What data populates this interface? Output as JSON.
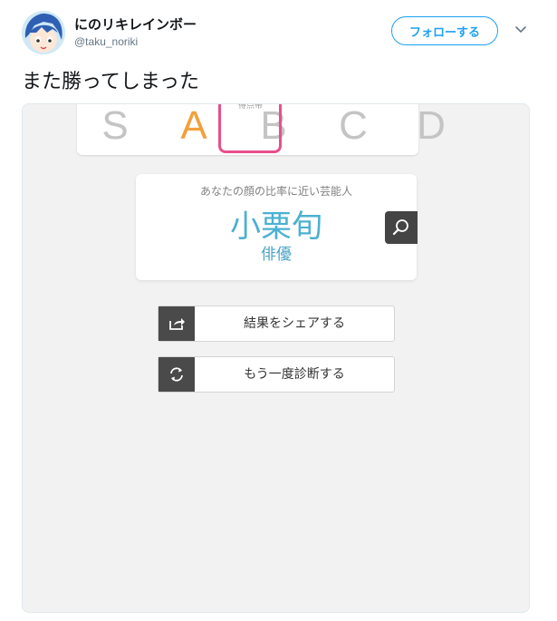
{
  "user": {
    "display_name": "にのリキレインボー",
    "handle": "@taku_noriki"
  },
  "follow_label": "フォローする",
  "tweet_text": "また勝ってしまった",
  "screenshot": {
    "grade_caption": "得点帯",
    "grades": [
      "S",
      "A",
      "B",
      "C",
      "D"
    ],
    "selected_grade": "A",
    "result_heading": "あなたの顔の比率に近い芸能人",
    "result_name": "小栗旬",
    "result_role": "俳優",
    "share_label": "結果をシェアする",
    "retry_label": "もう一度診断する"
  },
  "colors": {
    "accent_blue": "#1da1f2",
    "grade_highlight": "#e84f8d",
    "grade_active": "#f2a03c",
    "result_text": "#4bb1d2"
  },
  "icons": [
    "avatar",
    "chevron-down-icon",
    "magnifier-icon",
    "share-icon",
    "refresh-icon"
  ]
}
